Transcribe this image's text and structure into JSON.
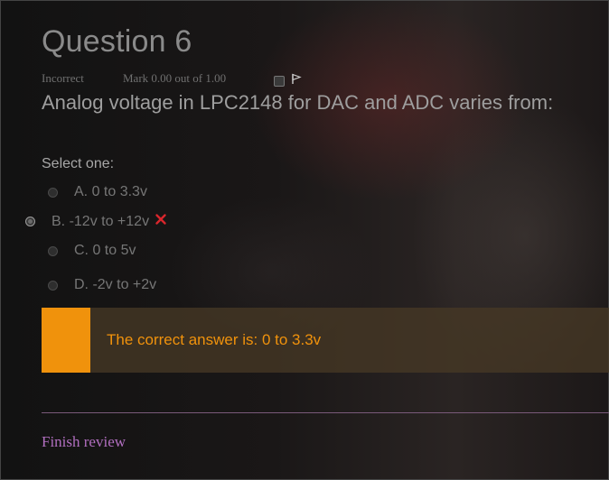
{
  "question": {
    "title": "Question 6",
    "status": "Incorrect",
    "mark": "Mark 0.00 out of 1.00",
    "text": "Analog voltage in LPC2148 for DAC and ADC varies from:",
    "prompt": "Select one:",
    "options": [
      {
        "label": "A. 0 to 3.3v",
        "selected": false
      },
      {
        "label": "B. -12v to +12v",
        "selected": true,
        "marked_wrong": true
      },
      {
        "label": "C. 0 to 5v",
        "selected": false
      },
      {
        "label": "D. -2v to +2v",
        "selected": false
      }
    ]
  },
  "feedback": {
    "text": "The correct answer is: 0 to 3.3v",
    "color": "#f0920c"
  },
  "icons": {
    "flag": "flag-icon",
    "wrong": "cross-icon"
  },
  "footer": {
    "finish_label": "Finish review"
  }
}
